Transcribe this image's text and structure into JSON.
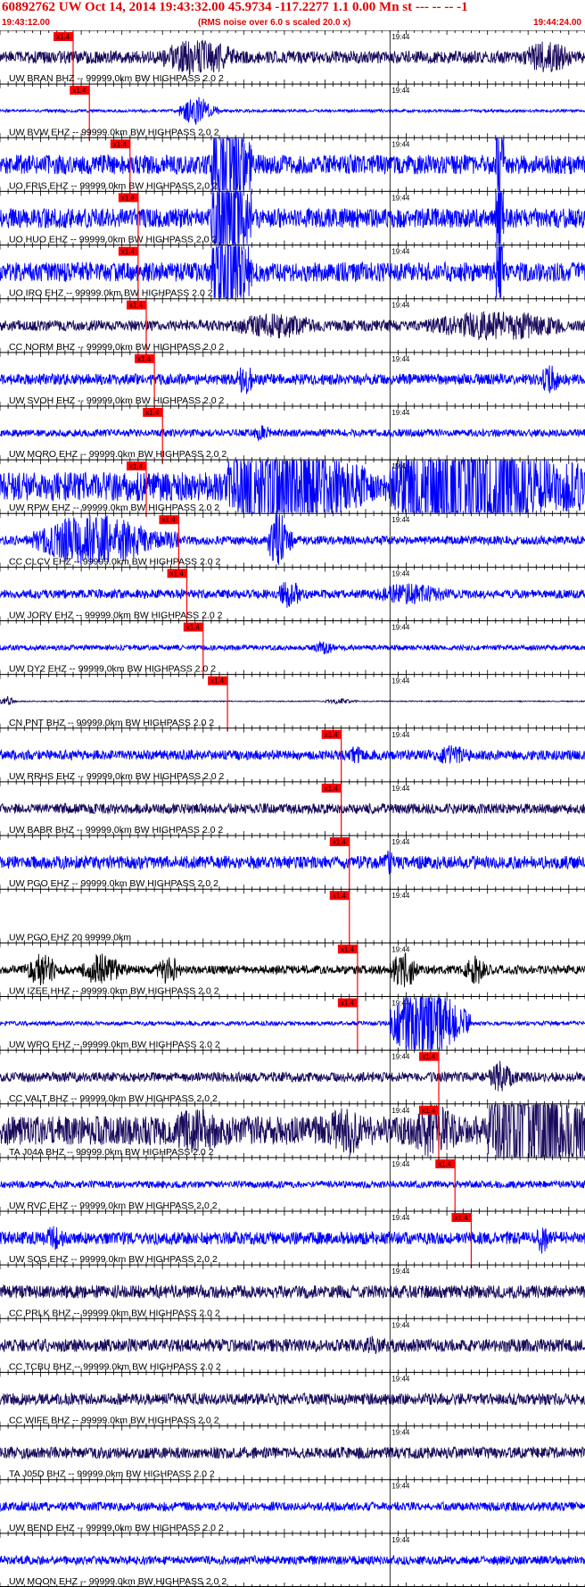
{
  "header": {
    "title": "60892762 UW Oct 14, 2014 19:43:32.00   45.9734 -117.2277  1.1 0.00 Mn st --- -- --   -1",
    "start_time": "19:43:12.00",
    "note": "(RMS noise over 6.0 s scaled 20.0 x)",
    "end_time": "19:44:24.00"
  },
  "colors": {
    "background": "#ffffff",
    "trace_blue": "#0000ff",
    "trace_dark": "#1a0a5c",
    "trace_black": "#000000",
    "pick": "#ff0000",
    "title": "#e00000"
  },
  "chart_data": {
    "type": "seismogram",
    "time_axis": {
      "start": "19:43:12",
      "end": "19:44:24",
      "minute_label": "19:44",
      "pick_label": "x1.4"
    },
    "traces": [
      {
        "label": "UW BRAN BHZ -- 99999.0km BW  HIGHPASS  2.0  2",
        "color": "dark",
        "pick": "19:43:21",
        "amp": 0.5,
        "noise": 0.35,
        "bursts": [
          [
            19,
            32,
            1.0
          ],
          [
            64,
            72,
            0.9
          ]
        ]
      },
      {
        "label": "UW BVW EHZ -- 99999.0km BW  HIGHPASS  2.0  2",
        "color": "blue",
        "pick": "19:43:23",
        "amp": 0.4,
        "noise": 0.1,
        "bursts": [
          [
            22,
            27,
            1.0
          ]
        ]
      },
      {
        "label": "UO FRIS EHZ -- 99999.0km BW  HIGHPASS  2.0  2",
        "color": "blue",
        "pick": "19:43:28",
        "amp": 0.9,
        "noise": 0.3,
        "bursts": [
          [
            26,
            31,
            2.5
          ],
          [
            61,
            62,
            3.0
          ]
        ]
      },
      {
        "label": "UO HUO EHZ -- 99999.0km BW  HIGHPASS  2.0  2",
        "color": "blue",
        "pick": "19:43:29",
        "amp": 0.9,
        "noise": 0.3,
        "bursts": [
          [
            26,
            31,
            2.5
          ],
          [
            61,
            62,
            3.0
          ]
        ]
      },
      {
        "label": "UO IRO EHZ -- 99999.0km BW  HIGHPASS  2.0  2",
        "color": "blue",
        "pick": "19:43:29",
        "amp": 0.9,
        "noise": 0.3,
        "bursts": [
          [
            26,
            31,
            2.5
          ],
          [
            61,
            62,
            3.0
          ]
        ]
      },
      {
        "label": "CC NORM BHZ -- 99999.0km BW  HIGHPASS  2.0  2",
        "color": "dark",
        "pick": "19:43:30",
        "amp": 0.6,
        "noise": 0.25,
        "bursts": [
          [
            28,
            42,
            0.6
          ],
          [
            52,
            74,
            0.7
          ]
        ]
      },
      {
        "label": "UW SVOH EHZ -- 99999.0km BW  HIGHPASS  2.0  2",
        "color": "blue",
        "pick": "19:43:31",
        "amp": 0.5,
        "noise": 0.3,
        "bursts": [
          [
            29,
            32,
            0.9
          ],
          [
            66,
            70,
            0.8
          ]
        ]
      },
      {
        "label": "UW MORO EHZ -- 99999.0km BW  HIGHPASS  2.0  2",
        "color": "blue",
        "pick": "19:43:32",
        "amp": 0.4,
        "noise": 0.25,
        "bursts": [
          [
            31,
            34,
            0.6
          ]
        ]
      },
      {
        "label": "UW RPW EHZ -- 99999.0km BW  HIGHPASS  2.0  2",
        "color": "blue",
        "pick": "19:43:30",
        "amp": 1.0,
        "noise": 0.4,
        "bursts": [
          [
            28,
            45,
            2.0
          ],
          [
            48,
            72,
            2.0
          ]
        ]
      },
      {
        "label": "CC CLCV EHZ -- 99999.0km BW  HIGHPASS  2.0  2",
        "color": "blue",
        "pick": "19:43:34",
        "amp": 0.6,
        "noise": 0.2,
        "bursts": [
          [
            4,
            22,
            1.2
          ],
          [
            33,
            36,
            1.4
          ]
        ]
      },
      {
        "label": "UW JORV EHZ -- 99999.0km BW  HIGHPASS  2.0  2",
        "color": "blue",
        "pick": "19:43:35",
        "amp": 0.5,
        "noise": 0.25,
        "bursts": [
          [
            34,
            38,
            0.8
          ],
          [
            45,
            58,
            0.6
          ]
        ]
      },
      {
        "label": "UW DY2 EHZ -- 99999.0km BW  HIGHPASS  2.0  2",
        "color": "blue",
        "pick": "19:43:37",
        "amp": 0.4,
        "noise": 0.18,
        "bursts": [
          [
            38,
            42,
            0.5
          ]
        ]
      },
      {
        "label": "CN PNT BHZ -- 99999.0km BW  HIGHPASS  2.0  2",
        "color": "dark",
        "pick": "19:43:40",
        "amp": 0.15,
        "noise": 0.1,
        "bursts": [
          [
            0,
            2,
            1.0
          ],
          [
            40,
            44,
            0.6
          ]
        ]
      },
      {
        "label": "UW RRHS EHZ -- 99999.0km BW  HIGHPASS  2.0  2",
        "color": "blue",
        "pick": "19:43:54",
        "amp": 0.45,
        "noise": 0.3,
        "bursts": [
          [
            43,
            45,
            0.6
          ],
          [
            52,
            60,
            0.6
          ]
        ]
      },
      {
        "label": "UW BABR BHZ -- 99999.0km BW  HIGHPASS  2.0  2",
        "color": "dark",
        "pick": "19:43:54",
        "amp": 0.4,
        "noise": 0.35,
        "bursts": []
      },
      {
        "label": "UW PGO EHZ -- 99999.0km BW  HIGHPASS  2.0  2",
        "color": "blue",
        "pick": "19:43:55",
        "amp": 0.45,
        "noise": 0.4,
        "bursts": [
          [
            47,
            49,
            0.8
          ]
        ]
      },
      {
        "label": "UW PGO EHZ 20 99999.0km",
        "color": "blue",
        "pick": "19:43:55",
        "amp": 0.0,
        "noise": 0.0,
        "bursts": []
      },
      {
        "label": "UW IZEE HHZ -- 99999.0km BW  HIGHPASS  2.0  2",
        "color": "black",
        "pick": "19:43:56",
        "amp": 0.5,
        "noise": 0.25,
        "bursts": [
          [
            3,
            8,
            0.9
          ],
          [
            10,
            16,
            0.9
          ],
          [
            19,
            23,
            0.8
          ],
          [
            48,
            52,
            1.1
          ],
          [
            57,
            61,
            0.8
          ]
        ]
      },
      {
        "label": "UW WPO EHZ -- 99999.0km BW  HIGHPASS  2.0  2",
        "color": "blue",
        "pick": "19:43:56",
        "amp": 0.4,
        "noise": 0.15,
        "bursts": [
          [
            48,
            58,
            3.0
          ]
        ]
      },
      {
        "label": "CC VALT BHZ -- 99999.0km BW  HIGHPASS  2.0  2",
        "color": "dark",
        "pick": "19:44:06",
        "amp": 0.45,
        "noise": 0.3,
        "bursts": [
          [
            60,
            64,
            1.0
          ]
        ]
      },
      {
        "label": "TA J04A BHZ -- 99999.0km BW  HIGHPASS  2.0  2",
        "color": "dark",
        "pick": "19:44:06",
        "amp": 0.8,
        "noise": 0.5,
        "bursts": [
          [
            20,
            30,
            0.8
          ],
          [
            40,
            46,
            0.9
          ],
          [
            50,
            58,
            1.0
          ],
          [
            60,
            72,
            3.0
          ]
        ]
      },
      {
        "label": "UW RVC EHZ -- 99999.0km BW  HIGHPASS  2.0  2",
        "color": "blue",
        "pick": "19:44:08",
        "amp": 0.4,
        "noise": 0.25,
        "bursts": []
      },
      {
        "label": "UW SQS EHZ -- 99999.0km BW  HIGHPASS  2.0  2",
        "color": "blue",
        "pick": "19:44:10",
        "amp": 0.5,
        "noise": 0.35,
        "bursts": [
          [
            5,
            9,
            0.7
          ],
          [
            66,
            68,
            0.9
          ]
        ]
      },
      {
        "label": "CC PRLK BHZ -- 99999.0km BW  HIGHPASS  2.0  2",
        "color": "dark",
        "pick": "",
        "amp": 0.45,
        "noise": 0.4,
        "bursts": []
      },
      {
        "label": "CC TCBU BHZ -- 99999.0km BW  HIGHPASS  2.0  2",
        "color": "dark",
        "pick": "",
        "amp": 0.45,
        "noise": 0.4,
        "bursts": [
          [
            44,
            48,
            0.6
          ]
        ]
      },
      {
        "label": "CC WIFE BHZ -- 99999.0km BW  HIGHPASS  2.0  2",
        "color": "dark",
        "pick": "",
        "amp": 0.4,
        "noise": 0.4,
        "bursts": []
      },
      {
        "label": "TA J05D BHZ -- 99999.0km BW  HIGHPASS  2.0  2",
        "color": "dark",
        "pick": "",
        "amp": 0.4,
        "noise": 0.4,
        "bursts": []
      },
      {
        "label": "UW BEND EHZ -- 99999.0km BW  HIGHPASS  2.0  2",
        "color": "blue",
        "pick": "",
        "amp": 0.35,
        "noise": 0.35,
        "bursts": []
      },
      {
        "label": "UW MOON EHZ -- 99999.0km BW  HIGHPASS  2.0  2",
        "color": "blue",
        "pick": "",
        "amp": 0.35,
        "noise": 0.35,
        "bursts": []
      }
    ]
  }
}
